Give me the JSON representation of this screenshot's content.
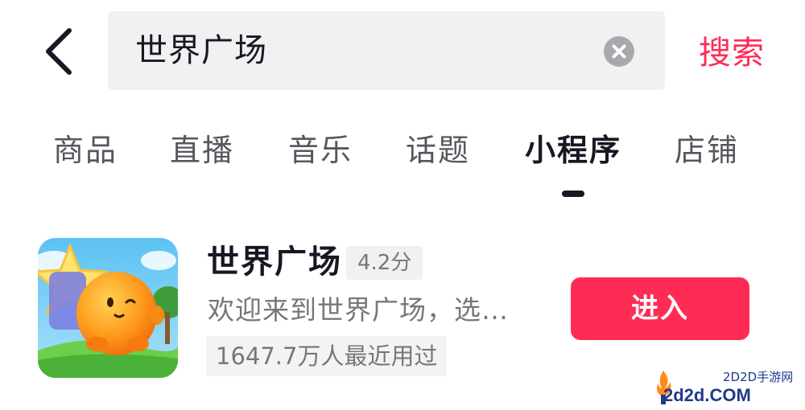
{
  "search": {
    "query": "世界广场",
    "submit_label": "搜索"
  },
  "icons": {
    "back": "chevron-left-icon",
    "clear": "clear-icon"
  },
  "tabs": [
    {
      "label": "商品"
    },
    {
      "label": "直播"
    },
    {
      "label": "音乐"
    },
    {
      "label": "话题"
    },
    {
      "label": "小程序",
      "active": true
    },
    {
      "label": "店铺"
    }
  ],
  "result": {
    "name": "世界广场",
    "rating": "4.2分",
    "description": "欢迎来到世界广场，选…",
    "usage": "1647.7万人最近用过",
    "enter_label": "进入"
  },
  "watermark": {
    "cn": "2D2D手游网",
    "en": "2d2d.COM"
  },
  "colors": {
    "accent": "#fe2c55",
    "text_primary": "#161823",
    "text_secondary": "#76777c",
    "search_bg": "#f1f1f2"
  }
}
